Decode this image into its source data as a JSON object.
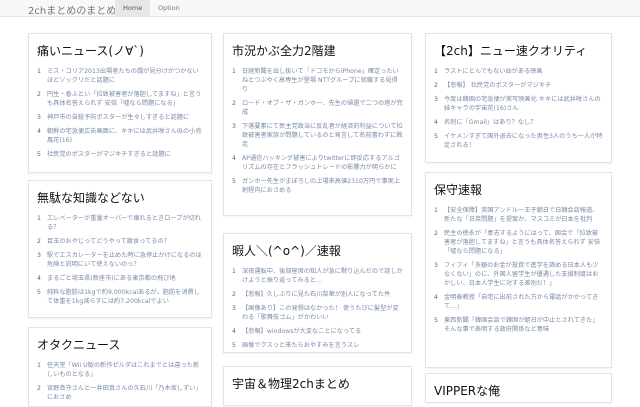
{
  "nav": {
    "brand": "2chまとめのまとめ",
    "tabs": [
      "Home",
      "Option"
    ]
  },
  "columns": [
    [
      {
        "title": "痛いニュース(ノ∀`)",
        "items": [
          "ミス・コリア2013出場者たちの顔が見分けがつかないほどソックリだと話題に",
          "円生・香ふとい「拉致被害者が落胆してますね」と言うも具体名答えられず 安倍「嘘なら問題になる」",
          "神戸市の自殺予防ポスターが生々しすぎると話題に",
          "朝鮮の宅急便広告画面に、キキには武井咲さん似の小売風花(16)",
          "社民党のポスターがマジキチすぎると話題に"
        ]
      },
      {
        "title": "無駄な知識などない",
        "items": [
          "エレベーターが重量オーバーで壊れるときロープが切れる？",
          "目玉のおやじってどうやって飯食ってるの？",
          "駅でエスカレーターを止めた時に急停止かけになるのは危険と説明にいて使えないのっ？",
          "まるごと埼玉県(新座市)にある東京都の飛び地",
          "純粋な脂肪は1kgで約9,000kcalあるが、脂肪を消費して体重を1kg減らすには約7,200kcalでよい"
        ]
      },
      {
        "title": "オタクニュース",
        "items": [
          "任天堂「Wii U版の新作ゼルダはこれまでとは違った新しいものとなる」",
          "宮野真守さんと一井田真さんの久石川「乃木坂しずい」におさめ"
        ]
      }
    ],
    [
      {
        "title": "市況かぶ全力2階建",
        "items": [
          "日経新聞を出し抜いて「ドコモからiPhone」確定ったいねとつぶやく高専生が登場 NTTグループに就職する見得り",
          "ロード・オブ・ザ・ガンホー、先生の帰還で二つの塔が完成",
          "下落要素にて民主党政治に反乱者が経済的利益について拉致被害者家族が問題しているのと発言して名前書わずに敗走",
          "AP通信ハッキング被害によりtwitterに即反応するアルゴリズムの存在とフラッシュトレードの影響力が明らかに",
          "ガンホー先生がまぼろしの上場来高値2310万円で事実上射程内におさめる"
        ]
      },
      {
        "title": "暇人＼(^o^)／速報",
        "items": [
          "深夜運転中、後部座席の知人が急に黙り込んだので話しかけようと振り返ってみると…",
          "【悲報】久しぶりに見た石川梨華が別人になってた件",
          "【画像あり】この発想はなかった！ 使うたびに髪型が変わる「歌舞伎ゴム」がかわいい",
          "【悲報】windowsが大変なことになってる",
          "画像でクスっと来たらおやすみを言うスレ"
        ]
      },
      {
        "title": "宇宙＆物理2chまとめ",
        "items": []
      }
    ],
    [
      {
        "title": "【2ch】ニュー速クオリティ",
        "items": [
          "ラストにとんでもない凶がある映画",
          "【悲報】 社民党のポスターがマジキチ",
          "今度は韓国の宅急便が実写映画化 キキには武井咲さんの妹キャラの宇宙花(16)さん",
          "名刺に「Gmail」はあり？なし？",
          "イケメンすぎて国外退去になった男性3人のうち一人が特定される！"
        ]
      },
      {
        "title": "保守速報",
        "items": [
          "【安全保障】英国アンドルー王子朝日で日韓会談報道、新たな「日英問題」を提案か、マスコミが日本を批判",
          "民主の徳永が「意志するようにはって、国会で「拉致被害者が落胆してますね」と言うも具体名答えられず 安倍「嘘なら問題になる」",
          "フィフィ「多額のお金が投資で進学を諦める日本人も少なくない」のに、外国人留学生が優遇した支援制度はおかしい、日本人学生に対する差別だ！」",
          "金明泰教授「自宅に出前された方から電話がかかってきて…」",
          "東西新聞「韓国会談で韓国が朝日が中止とされてきた」そんな事で表明する政府関係など意味"
        ]
      },
      {
        "title": "VIPPERな俺",
        "items": []
      }
    ]
  ]
}
